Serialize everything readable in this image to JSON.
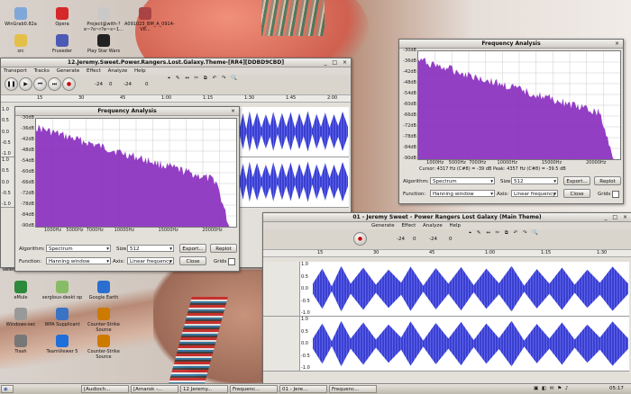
{
  "desktop": {
    "icons": [
      {
        "label": "WinGrab0.82a",
        "color": "#7fa8d8"
      },
      {
        "label": "Opera",
        "color": "#d62828"
      },
      {
        "label": "Project@with-?e~?o~r?e~s~1...",
        "color": "#c9c9c9"
      },
      {
        "label": "A091023_BM_A_0914-V8...",
        "color": "#a44"
      },
      {
        "label": "src",
        "color": "#e4c04a"
      },
      {
        "label": "Fruxeder",
        "color": "#4b5bb5"
      },
      {
        "label": "Play Star Wars",
        "color": "#222"
      },
      {
        "label": "eMule",
        "color": "#2c8a3a"
      },
      {
        "label": "serglous-deskt op",
        "color": "#8b6"
      },
      {
        "label": "Google Earth",
        "color": "#2a6fd0"
      },
      {
        "label": "Windows-sec",
        "color": "#999"
      },
      {
        "label": "WPA Supplicant",
        "color": "#3b73c4"
      },
      {
        "label": "Counter-Strike Source",
        "color": "#cc7a00"
      },
      {
        "label": "Trash",
        "color": "#777"
      },
      {
        "label": "TeamViewer 5",
        "color": "#1e6fd9"
      },
      {
        "label": "Counter-Strike Source",
        "color": "#cc7a00"
      }
    ]
  },
  "audacity_left": {
    "title": "12.Jeremy.Sweet.Power.Rangers.Lost.Galaxy.Theme-[RR4][DDBD9CBD]",
    "menu": [
      "Transport",
      "Tracks",
      "Generate",
      "Effect",
      "Analyze",
      "Help"
    ],
    "meter_labels": [
      "-24",
      "0",
      "-24",
      "0"
    ],
    "ruler": [
      "15",
      "30",
      "45",
      "1:00",
      "1:15",
      "1:30",
      "1:45",
      "2:00"
    ],
    "track_vals": [
      "1.0",
      "0.5",
      "0.0",
      "-0.5",
      "-1.0",
      "1.0",
      "0.5",
      "0.0",
      "-0.5",
      "-1.0"
    ],
    "select_label": "select"
  },
  "freq_left": {
    "title": "Frequency Analysis",
    "y_labels": [
      "-30dB",
      "-36dB",
      "-42dB",
      "-48dB",
      "-54dB",
      "-60dB",
      "-66dB",
      "-72dB",
      "-78dB",
      "-84dB",
      "-90dB"
    ],
    "x_labels": [
      "1000Hz",
      "5000Hz",
      "7000Hz",
      "10000Hz",
      "15000Hz",
      "20000Hz"
    ],
    "cursor": "",
    "algorithm_label": "Algorithm:",
    "algorithm_value": "Spectrum",
    "size_label": "Size:",
    "size_value": "512",
    "export_label": "Export...",
    "replot_label": "Replot",
    "function_label": "Function:",
    "function_value": "Hanning window",
    "axis_label": "Axis:",
    "axis_value": "Linear frequency",
    "close_label": "Close",
    "grids_label": "Grids"
  },
  "freq_right": {
    "title": "Frequency Analysis",
    "y_labels": [
      "-30dB",
      "-36dB",
      "-42dB",
      "-48dB",
      "-54dB",
      "-60dB",
      "-66dB",
      "-72dB",
      "-78dB",
      "-84dB",
      "-90dB"
    ],
    "x_labels": [
      "1000Hz",
      "5000Hz",
      "7000Hz",
      "10000Hz",
      "15000Hz",
      "20000Hz"
    ],
    "cursor": "Cursor: 4317 Hz (C#8) = -39 dB    Peak: 4357 Hz (C#8) = -39.5 dB",
    "algorithm_label": "Algorithm:",
    "algorithm_value": "Spectrum",
    "size_label": "Size:",
    "size_value": "512",
    "export_label": "Export...",
    "replot_label": "Replot",
    "function_label": "Function:",
    "function_value": "Hanning window",
    "axis_label": "Axis:",
    "axis_value": "Linear frequency",
    "close_label": "Close",
    "grids_label": "Grids"
  },
  "audacity_right": {
    "title": "01 - Jeremy Sweet - Power Rangers Lost Galaxy (Main Theme)",
    "menu": [
      "Generate",
      "Effect",
      "Analyze",
      "Help"
    ],
    "meter_labels": [
      "-24",
      "0",
      "-24",
      "0"
    ],
    "ruler": [
      "15",
      "30",
      "45",
      "1:00",
      "1:15",
      "1:30"
    ],
    "track_vals": [
      "1.0",
      "0.5",
      "0.0",
      "-0.5",
      "-1.0",
      "1.0",
      "0.5",
      "0.0",
      "-0.5",
      "-1.0"
    ]
  },
  "taskbar": {
    "tasks": [
      "[Audioch...",
      "[Amarok -...",
      "12 Jeremy...",
      "Frequenc...",
      "01 - Jere...",
      "Frequenc..."
    ],
    "clock": "05:17",
    "brand": "#3a5fb0"
  }
}
